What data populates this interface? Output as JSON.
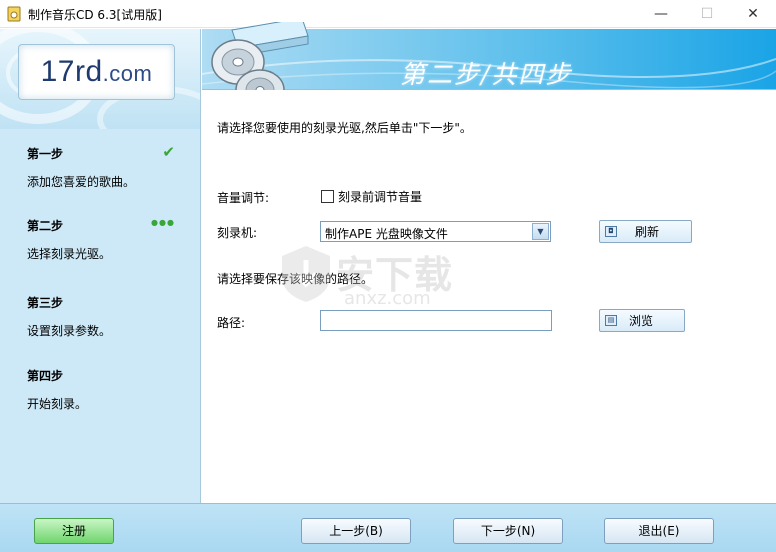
{
  "window": {
    "title": "制作音乐CD 6.3[试用版]",
    "minimize": "—",
    "maximize": "☐",
    "close": "✕"
  },
  "sidebar": {
    "logo_main": "17rd",
    "logo_suffix": ".com",
    "steps": [
      {
        "title": "第一步",
        "desc": "添加您喜爱的歌曲。",
        "status": "done"
      },
      {
        "title": "第二步",
        "desc": "选择刻录光驱。",
        "status": "current"
      },
      {
        "title": "第三步",
        "desc": "设置刻录参数。",
        "status": "pending"
      },
      {
        "title": "第四步",
        "desc": "开始刻录。",
        "status": "pending"
      }
    ],
    "current_marker": "●●●",
    "done_marker": "✔"
  },
  "header": {
    "banner_title": "第二步/共四步"
  },
  "main": {
    "instruction": "请选择您要使用的刻录光驱,然后单击\"下一步\"。",
    "volume_label": "音量调节:",
    "volume_checkbox_label": "刻录前调节音量",
    "volume_checked": false,
    "burner_label": "刻录机:",
    "burner_selected": "制作APE 光盘映像文件",
    "refresh_label": "刷新",
    "path_hint": "请选择要保存该映像的路径。",
    "path_label": "路径:",
    "path_value": "",
    "browse_label": "浏览"
  },
  "watermark": {
    "text": "安下载",
    "sub": "anxz.com"
  },
  "footer": {
    "register_label": "注册",
    "prev_label": "上一步(B)",
    "next_label": "下一步(N)",
    "exit_label": "退出(E)"
  },
  "colors": {
    "sidebar_bg": "#cde8f6",
    "banner_start": "#aedcf3",
    "banner_end": "#1aa4e6",
    "check_green": "#3aa63a",
    "register_green": "#6fd56c"
  }
}
